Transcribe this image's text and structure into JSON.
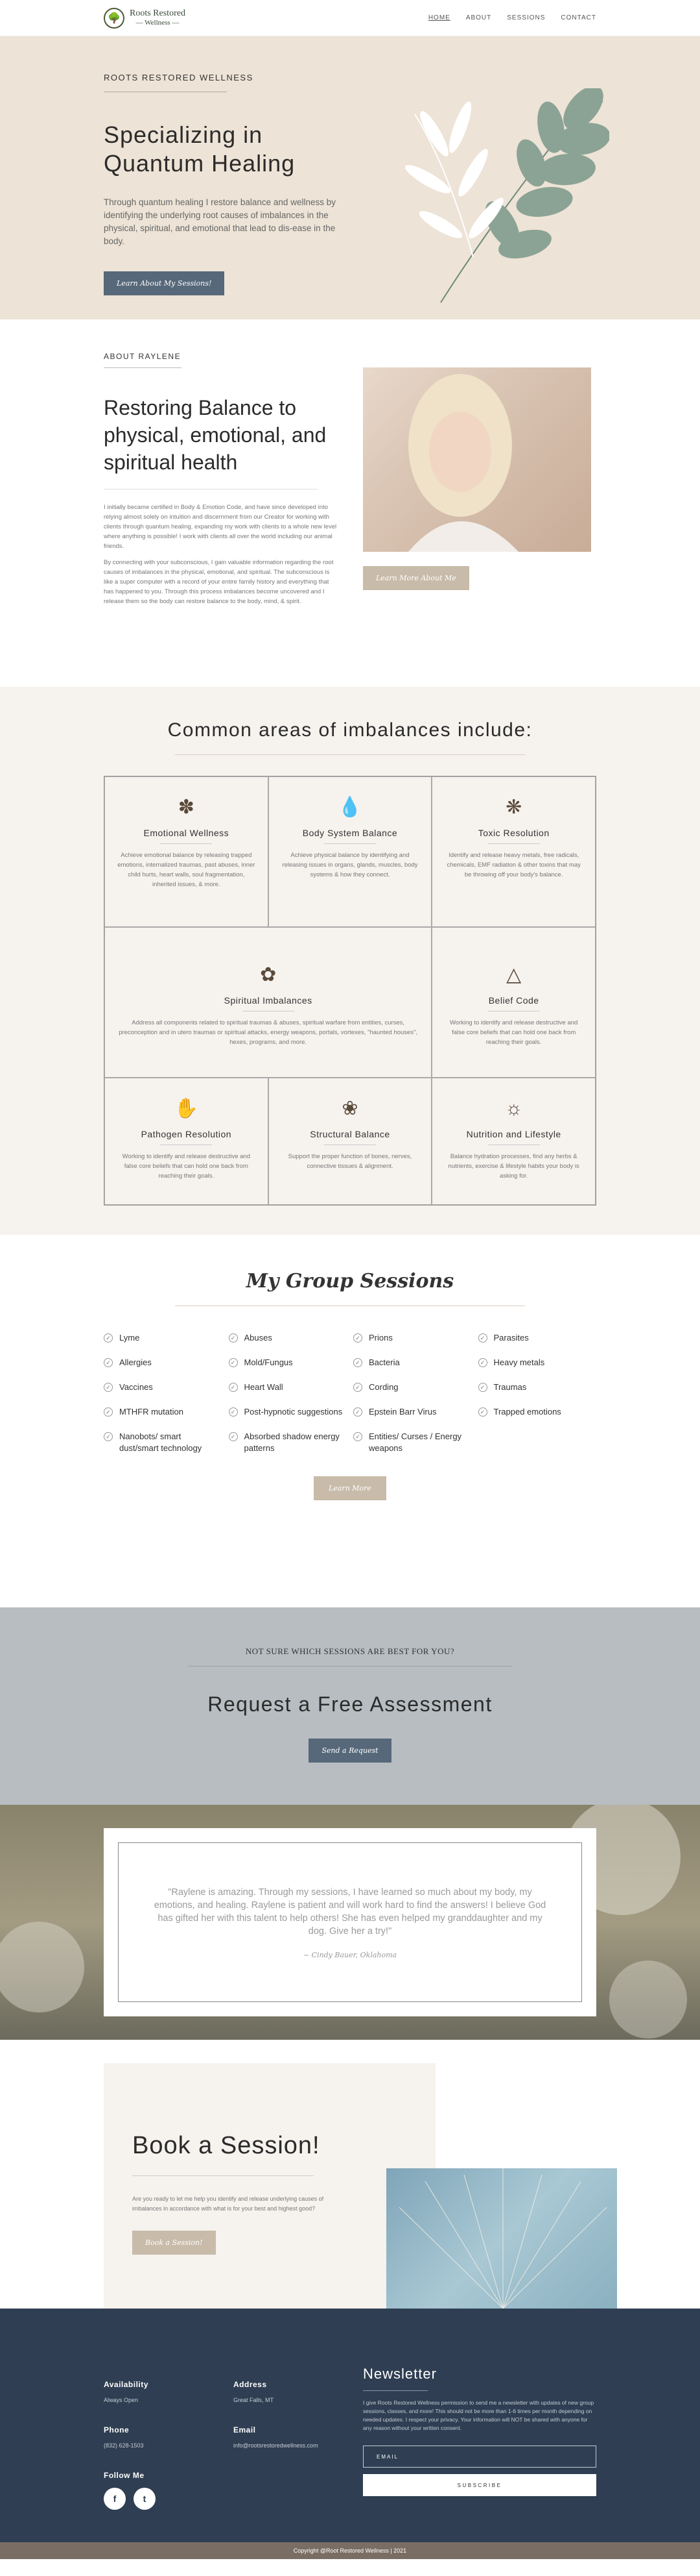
{
  "brand": {
    "name_line1": "Roots Restored",
    "name_line2": "— Wellness —"
  },
  "nav": {
    "items": [
      {
        "label": "HOME"
      },
      {
        "label": "ABOUT"
      },
      {
        "label": "SESSIONS"
      },
      {
        "label": "CONTACT"
      }
    ]
  },
  "hero": {
    "eyebrow": "ROOTS RESTORED WELLNESS",
    "title": "Specializing in Quantum Healing",
    "body": "Through quantum healing I restore balance and wellness by identifying the underlying root causes of imbalances in the physical, spiritual, and emotional that lead to dis-ease in the body.",
    "button": "Learn About My Sessions!"
  },
  "about": {
    "eyebrow": "ABOUT RAYLENE",
    "title": "Restoring Balance to physical, emotional, and spiritual health",
    "p1": "I initially became certified in Body & Emotion Code, and have since developed into relying almost solely on intuition and discernment from our Creator for working with clients through quantum healing, expanding my work with clients to a whole new level where anything is possible! I work with clients all over the world including our animal friends.",
    "p2": "By connecting with your subconscious, I gain valuable information regarding the root causes of imbalances in the physical, emotional, and spiritual. The subconscious is like a super computer with a record of your entire family history and everything that has happened to you. Through this process imbalances become uncovered and I release them so the body can restore balance to the body, mind, & spirit.",
    "button": "Learn More About Me"
  },
  "imbalances": {
    "title": "Common areas of imbalances include:",
    "cells": [
      {
        "icon": "lotus-mandala-icon",
        "title": "Emotional Wellness",
        "body": "Achieve emotional balance by releasing trapped emotions, internalized traumas, past abuses, inner child hurts, heart walls, soul fragmentation, inherited issues, & more."
      },
      {
        "icon": "water-drop-icon",
        "title": "Body System Balance",
        "body": "Achieve physical balance by identifying and releasing issues in organs, glands, muscles, body systems & how they connect."
      },
      {
        "icon": "spiral-star-icon",
        "title": "Toxic Resolution",
        "body": "Identify and release heavy metals, free radicals, chemicals, EMF radiation & other toxins that may be throwing off your body's balance."
      },
      {
        "icon": "lotus-icon",
        "title": "Spiritual Imbalances",
        "body": "Address all components related to spiritual traumas & abuses, spiritual warfare from entities, curses, preconception and in utero traumas or spiritual attacks, energy weapons, portals, vortexes, \"haunted houses\", hexes, programs, and more."
      },
      {
        "icon": "triangle-lotus-icon",
        "title": "Belief Code",
        "body": "Working to identify and release destructive and false core beliefs that can hold one back from reaching their goals."
      },
      {
        "icon": "hamsa-hand-icon",
        "title": "Pathogen Resolution",
        "body": "Working to identify and release destructive and false core beliefs that can hold one back from reaching their goals."
      },
      {
        "icon": "lotus-outline-icon",
        "title": "Structural Balance",
        "body": "Support the proper function of bones, nerves, connective tissues & alignment."
      },
      {
        "icon": "sun-mandala-icon",
        "title": "Nutrition and Lifestyle",
        "body": "Balance hydration processes, find any herbs & nutrients, exercise & lifestyle habits your body is asking for."
      }
    ]
  },
  "group": {
    "title": "My Group Sessions",
    "items": [
      "Lyme",
      "Abuses",
      "Prions",
      "Parasites",
      "Allergies",
      "Mold/Fungus",
      "Bacteria",
      "Heavy metals",
      "Vaccines",
      "Heart Wall",
      "Cording",
      "Traumas",
      "MTHFR mutation",
      "Post-hypnotic suggestions",
      "Epstein Barr Virus",
      "Trapped emotions",
      "Nanobots/ smart dust/smart technology",
      "Absorbed shadow energy patterns",
      "Entities/ Curses / Energy weapons"
    ],
    "button": "Learn More"
  },
  "assessment": {
    "small": "NOT SURE WHICH SESSIONS ARE BEST FOR YOU?",
    "title": "Request a Free Assessment",
    "button": "Send a Request"
  },
  "testimonial": {
    "quote": "\"Raylene is amazing. Through my sessions, I have learned so much about my body, my emotions, and healing. Raylene is patient and will work hard to find the answers! I believe God has gifted her with this talent to help others! She has even helped my granddaughter and my dog. Give her a try!\"",
    "author": "~ Cindy Bauer, Oklahoma"
  },
  "book": {
    "title": "Book a Session!",
    "body": "Are you ready to let me help you identify and release underlying causes of imbalances in accordance with what is for your best and highest good?",
    "button": "Book a Session!"
  },
  "footer": {
    "availability_label": "Availability",
    "availability_value": "Always Open",
    "address_label": "Address",
    "address_value": "Great Falls, MT",
    "phone_label": "Phone",
    "phone_value": "(832) 628-1503",
    "email_label": "Email",
    "email_value": "info@rootsrestoredwellness.com",
    "follow_label": "Follow Me",
    "newsletter_title": "Newsletter",
    "newsletter_body": "I give Roots Restored Wellness permission to send me a newsletter with updates of new group sessions, classes, and more! This should not be more than 1-6 times per month depending on needed updates. I respect your privacy. Your information will NOT be shared with anyone for any reason without your written consent.",
    "email_placeholder": "EMAIL",
    "subscribe": "SUBSCRIBE",
    "copyright": "Copyright @Root Restored Wellness | 2021"
  }
}
